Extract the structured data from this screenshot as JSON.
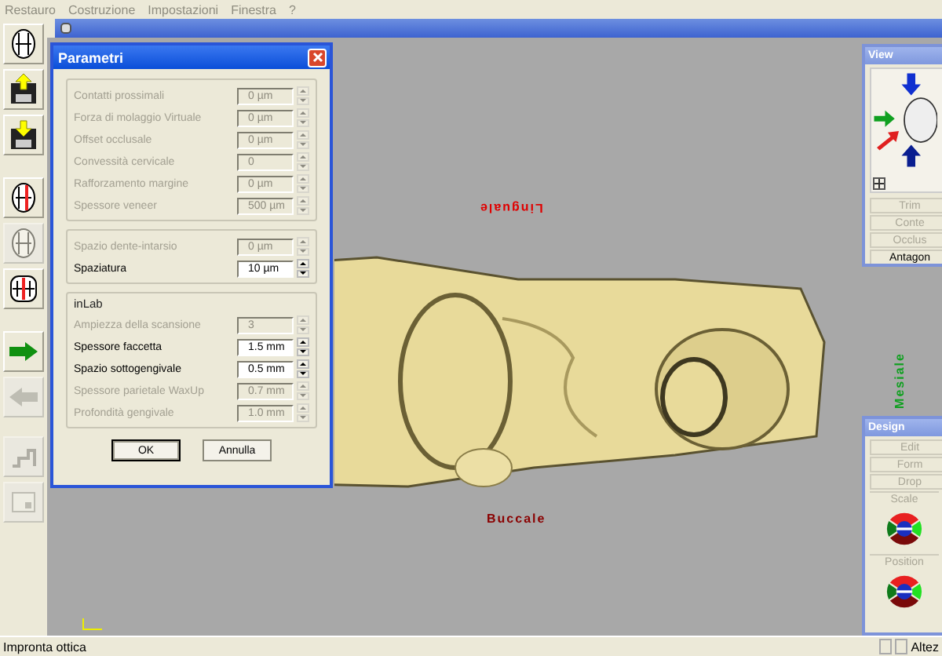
{
  "menu": [
    {
      "label": "Restauro"
    },
    {
      "label": "Costruzione"
    },
    {
      "label": "Impostazioni"
    },
    {
      "label": "Finestra"
    },
    {
      "label": "?"
    }
  ],
  "toolbar": [
    {
      "kind": "tooth",
      "disabled": false
    },
    {
      "kind": "save-up",
      "disabled": false
    },
    {
      "kind": "save-down",
      "disabled": false
    },
    {
      "kind": "tooth-marked",
      "disabled": false
    },
    {
      "kind": "tooth",
      "disabled": true
    },
    {
      "kind": "tooth-face",
      "disabled": false
    },
    {
      "kind": "arrow-right",
      "disabled": false
    },
    {
      "kind": "arrow-left",
      "disabled": true
    },
    {
      "kind": "tool",
      "disabled": true
    },
    {
      "kind": "panel",
      "disabled": true
    }
  ],
  "viewport": {
    "top_label": "Linguale",
    "bottom_label": "Buccale",
    "side_label": "Mesiale"
  },
  "dialog": {
    "title": "Parametri",
    "groups": [
      {
        "rows": [
          {
            "label": "Contatti prossimali",
            "value": "0 µm",
            "disabled": true
          },
          {
            "label": "Forza di molaggio Virtuale",
            "value": "0 µm",
            "disabled": true
          },
          {
            "label": "Offset occlusale",
            "value": "0 µm",
            "disabled": true
          },
          {
            "label": "Convessità cervicale",
            "value": "0",
            "disabled": true
          },
          {
            "label": "Rafforzamento margine",
            "value": "0 µm",
            "disabled": true
          },
          {
            "label": "Spessore veneer",
            "value": "500 µm",
            "disabled": true
          }
        ]
      },
      {
        "rows": [
          {
            "label": "Spazio dente-intarsio",
            "value": "0 µm",
            "disabled": true
          },
          {
            "label": "Spaziatura",
            "value": "10 µm",
            "disabled": false
          }
        ]
      },
      {
        "title": "inLab",
        "rows": [
          {
            "label": "Ampiezza della scansione",
            "value": "3",
            "disabled": true
          },
          {
            "label": "Spessore faccetta",
            "value": "1.5 mm",
            "disabled": false
          },
          {
            "label": "Spazio sottogengivale",
            "value": "0.5 mm",
            "disabled": false
          },
          {
            "label": "Spessore parietale WaxUp",
            "value": "0.7 mm",
            "disabled": true
          },
          {
            "label": "Profondità gengivale",
            "value": "1.0 mm",
            "disabled": true
          }
        ]
      }
    ],
    "buttons": [
      {
        "label": "OK",
        "default": true
      },
      {
        "label": "Annulla",
        "default": false
      }
    ]
  },
  "view_panel": {
    "title": "View",
    "buttons": [
      {
        "label": "Trim",
        "disabled": true
      },
      {
        "label": "Conte",
        "disabled": true
      },
      {
        "label": "Occlus",
        "disabled": true
      },
      {
        "label": "Antagon",
        "disabled": false
      }
    ]
  },
  "design_panel": {
    "title": "Design",
    "buttons": [
      {
        "label": "Edit",
        "disabled": true
      },
      {
        "label": "Form",
        "disabled": true
      },
      {
        "label": "Drop",
        "disabled": true
      }
    ],
    "controls": [
      {
        "label": "Scale"
      },
      {
        "label": "Position"
      }
    ]
  },
  "status_bar": {
    "left": "Impronta ottica",
    "right": "Altez"
  }
}
